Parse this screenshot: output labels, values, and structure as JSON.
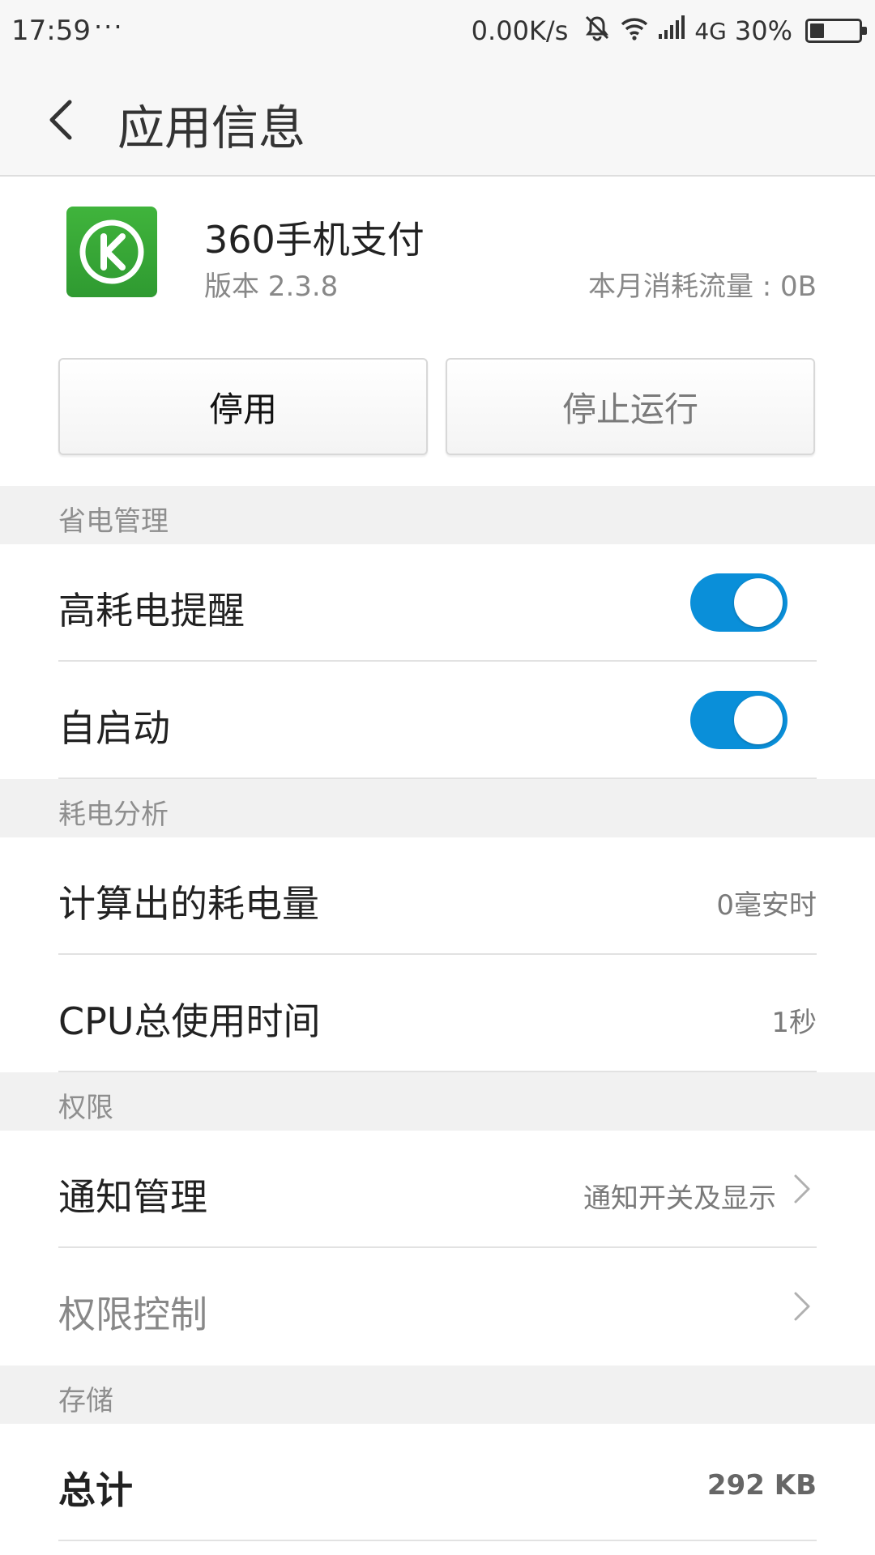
{
  "status_bar": {
    "time": "17:59",
    "dots": "···",
    "net_speed": "0.00K/s",
    "network": "4G",
    "battery": "30%",
    "battery_level": 0.3
  },
  "title_bar": {
    "title": "应用信息"
  },
  "app": {
    "name": "360手机支付",
    "version": "版本 2.3.8",
    "traffic": "本月消耗流量 : 0B",
    "icon_color": "#3aaa38"
  },
  "buttons": {
    "disable": "停用",
    "force_stop": "停止运行"
  },
  "sections": {
    "power_mgmt": {
      "header": "省电管理",
      "high_drain_alert": {
        "label": "高耗电提醒",
        "on": true
      },
      "auto_start": {
        "label": "自启动",
        "on": true
      }
    },
    "power_analysis": {
      "header": "耗电分析",
      "computed_power": {
        "label": "计算出的耗电量",
        "value": "0毫安时"
      },
      "cpu_time": {
        "label": "CPU总使用时间",
        "value": "1秒"
      }
    },
    "permissions": {
      "header": "权限",
      "notification": {
        "label": "通知管理",
        "value": "通知开关及显示"
      },
      "permission_control": {
        "label": "权限控制"
      }
    },
    "storage": {
      "header": "存储",
      "total": {
        "label": "总计",
        "value": "292 KB"
      }
    }
  },
  "colors": {
    "accent": "#0a8fd9",
    "section_bg": "#f1f1f1"
  }
}
